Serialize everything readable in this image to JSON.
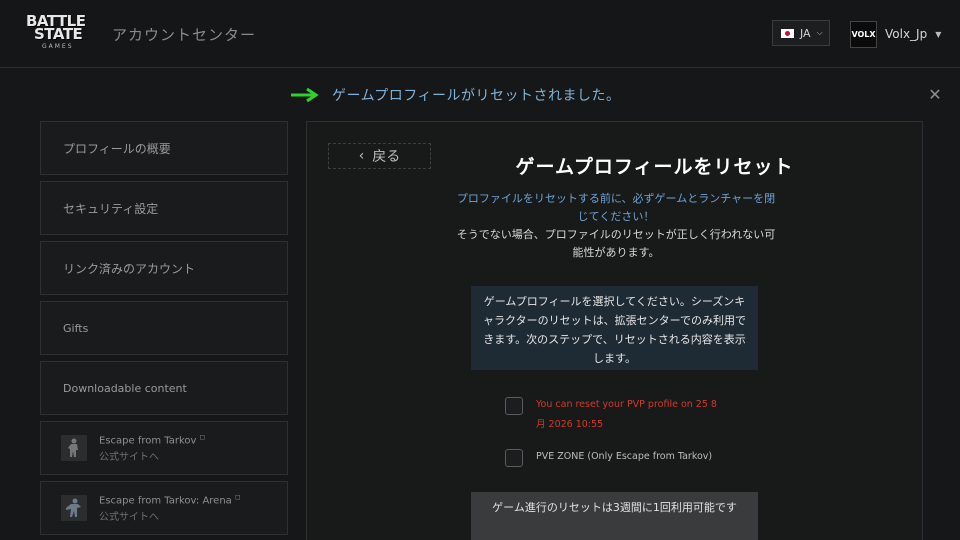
{
  "header": {
    "logo": {
      "line1": "BATTLE",
      "line2": "STATE",
      "line3": "GAMES"
    },
    "title": "アカウントセンター",
    "language": {
      "code": "JA",
      "flag": "japan-flag"
    },
    "user": {
      "avatar_text": "VOLX",
      "name": "Volx_Jp"
    }
  },
  "notification": {
    "text": "ゲームプロフィールがリセットされました。",
    "arrow_color": "#2fd12f"
  },
  "sidebar": {
    "items": [
      {
        "label": "プロフィールの概要"
      },
      {
        "label": "セキュリティ設定"
      },
      {
        "label": "リンク済みのアカウント"
      },
      {
        "label": "Gifts"
      },
      {
        "label": "Downloadable content"
      }
    ],
    "games": [
      {
        "title": "Escape from Tarkov",
        "link": "公式サイトへ"
      },
      {
        "title": "Escape from Tarkov: Arena",
        "link": "公式サイトへ"
      }
    ]
  },
  "main": {
    "back_label": "戻る",
    "title": "ゲームプロフィールをリセット",
    "warning_blue": "プロファイルをリセットする前に、必ずゲームとランチャーを閉じてください！",
    "warning_white": "そうでない場合、プロファイルのリセットが正しく行われない可能性があります。",
    "info_box": "ゲームプロフィールを選択してください。シーズンキャラクターのリセットは、拡張センターでのみ利用できます。次のステップで、リセットされる内容を表示します。",
    "options": [
      {
        "label": "You can reset your PVP profile on 25 8月 2026 10:55",
        "status_color": "#d33a2c"
      },
      {
        "label": "PVE ZONE (Only Escape from Tarkov)"
      }
    ],
    "bottom_banner": "ゲーム進行のリセットは3週間に1回利用可能です"
  }
}
